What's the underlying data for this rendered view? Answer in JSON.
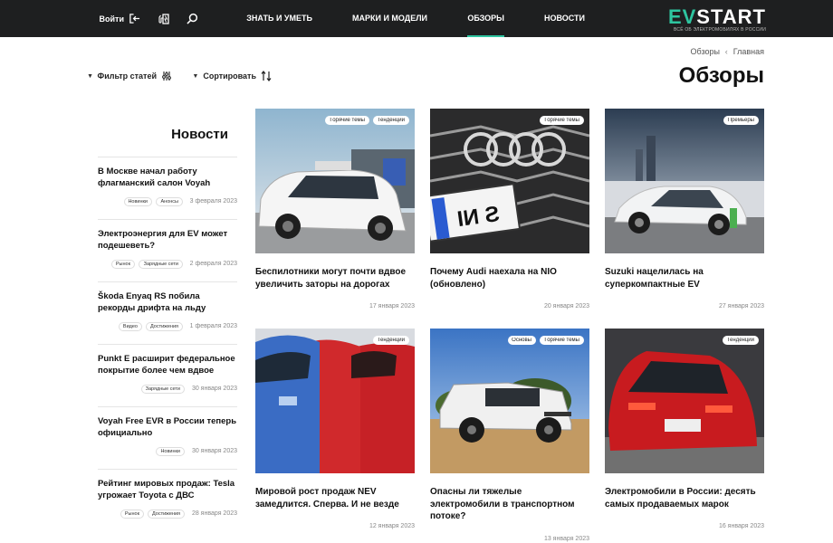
{
  "header": {
    "logo_main": "START",
    "logo_ev": "EV",
    "logo_sub": "ВСЁ ОБ ЭЛЕКТРОМОБИЛЯХ В РОССИИ",
    "nav": [
      {
        "label": "Новости",
        "active": false
      },
      {
        "label": "Обзоры",
        "active": true
      },
      {
        "label": "Марки и модели",
        "active": false
      },
      {
        "label": "Знать и уметь",
        "active": false
      }
    ],
    "login_label": "Войти"
  },
  "breadcrumb": {
    "home": "Главная",
    "current": "Обзоры"
  },
  "page_title": "Обзоры",
  "toolbar": {
    "sort_label": "Сортировать",
    "filter_label": "Фильтр статей"
  },
  "cards": [
    {
      "tags": [
        "Премьеры"
      ],
      "title": "Suzuki нацелилась на суперкомпактные EV",
      "date": "27 января 2023"
    },
    {
      "tags": [
        "Горячие темы"
      ],
      "title": "Почему Audi наехала на NIO (обновлено)",
      "date": "20 января 2023"
    },
    {
      "tags": [
        "Тенденции",
        "Горячие темы"
      ],
      "title": "Беспилотники могут почти вдвое увеличить заторы на дорогах",
      "date": "17 января 2023"
    },
    {
      "tags": [
        "Тенденции"
      ],
      "title": "Электромобили в России: десять самых продаваемых марок",
      "date": "16 января 2023"
    },
    {
      "tags": [
        "Горячие темы",
        "Основы"
      ],
      "title": "Опасны ли тяжелые электромобили в транспортном потоке?",
      "date": "13 января 2023"
    },
    {
      "tags": [
        "Тенденции"
      ],
      "title": "Мировой рост продаж NEV замедлится. Сперва. И не везде",
      "date": "12 января 2023"
    }
  ],
  "sidebar": {
    "title": "Новости",
    "items": [
      {
        "title": "В Москве начал работу флагманский салон Voyah",
        "date": "3 февраля 2023",
        "tags": [
          "Анонсы",
          "Новинки"
        ]
      },
      {
        "title": "Электроэнергия для EV может подешеветь?",
        "date": "2 февраля 2023",
        "tags": [
          "Зарядные сети",
          "Рынок"
        ]
      },
      {
        "title": "Škoda Enyaq RS побила рекорды дрифта на льду",
        "date": "1 февраля 2023",
        "tags": [
          "Достижения",
          "Видео"
        ]
      },
      {
        "title": "Punkt E расширит федеральное покрытие более чем вдвое",
        "date": "30 января 2023",
        "tags": [
          "Зарядные сети"
        ]
      },
      {
        "title": "Voyah Free EVR в России теперь официально",
        "date": "30 января 2023",
        "tags": [
          "Новинки"
        ]
      },
      {
        "title": "Рейтинг мировых продаж: Tesla угрожает Toyota с ДВС",
        "date": "28 января 2023",
        "tags": [
          "Достижения",
          "Рынок"
        ]
      }
    ]
  }
}
